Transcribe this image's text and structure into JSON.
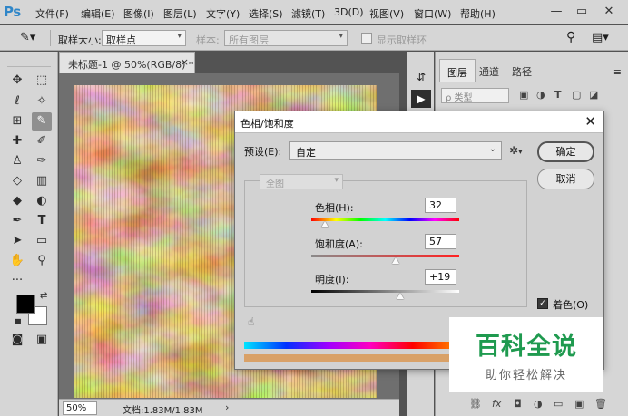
{
  "app": {
    "logo": "Ps"
  },
  "menubar": {
    "items": [
      "文件(F)",
      "编辑(E)",
      "图像(I)",
      "图层(L)",
      "文字(Y)",
      "选择(S)",
      "滤镜(T)",
      "3D(D)",
      "视图(V)",
      "窗口(W)",
      "帮助(H)"
    ],
    "window_controls": {
      "minimize": "—",
      "restore": "▭",
      "close": "✕"
    }
  },
  "options": {
    "sample_size_label": "取样大小:",
    "sample_size_value": "取样点",
    "sample_label": "样本:",
    "sample_value": "所有图层",
    "show_ring_label": "显示取样环"
  },
  "document": {
    "tab_title": "未标题-1 @ 50%(RGB/8) *",
    "tab_close": "×",
    "zoom": "50%",
    "doc_size": "文档:1.83M/1.83M",
    "status_arrow": "›"
  },
  "tools": {
    "items": [
      {
        "name": "move-tool",
        "glyph": "✥"
      },
      {
        "name": "marquee-tool",
        "glyph": "⬚"
      },
      {
        "name": "lasso-tool",
        "glyph": "ℓ"
      },
      {
        "name": "magic-wand-tool",
        "glyph": "✧"
      },
      {
        "name": "crop-tool",
        "glyph": "⊞"
      },
      {
        "name": "eyedropper-tool",
        "glyph": "✎"
      },
      {
        "name": "healing-tool",
        "glyph": "✚"
      },
      {
        "name": "brush-tool",
        "glyph": "✐"
      },
      {
        "name": "stamp-tool",
        "glyph": "♙"
      },
      {
        "name": "history-brush-tool",
        "glyph": "✑"
      },
      {
        "name": "eraser-tool",
        "glyph": "◇"
      },
      {
        "name": "gradient-tool",
        "glyph": "▥"
      },
      {
        "name": "blur-tool",
        "glyph": "◆"
      },
      {
        "name": "dodge-tool",
        "glyph": "◐"
      },
      {
        "name": "pen-tool",
        "glyph": "✒"
      },
      {
        "name": "type-tool",
        "glyph": "T"
      },
      {
        "name": "path-select-tool",
        "glyph": "➤"
      },
      {
        "name": "shape-tool",
        "glyph": "▭"
      },
      {
        "name": "hand-tool",
        "glyph": "✋"
      },
      {
        "name": "zoom-tool",
        "glyph": "⚲"
      }
    ],
    "more": "···",
    "foreground_color": "#000000",
    "background_color": "#ffffff",
    "quick_mask": "◙",
    "screen_mode": "▣"
  },
  "layers_panel": {
    "tabs": [
      "图层",
      "通道",
      "路径"
    ],
    "menu_icon": "≡",
    "filter_placeholder": "ρ 类型",
    "filter_icons": [
      "▣",
      "◑",
      "T",
      "▢",
      "◪"
    ],
    "footer_icons": [
      "⛓",
      "fx",
      "◘",
      "◑",
      "▭",
      "▣",
      "🗑"
    ]
  },
  "dialog": {
    "title": "色相/饱和度",
    "close": "✕",
    "preset_label": "预设(E):",
    "preset_value": "自定",
    "gear": "✲",
    "channel": "全图",
    "ok": "确定",
    "cancel": "取消",
    "hue_label": "色相(H):",
    "hue_value": "32",
    "hue_frac": 0.09,
    "saturation_label": "饱和度(A):",
    "saturation_value": "57",
    "saturation_frac": 0.57,
    "lightness_label": "明度(I):",
    "lightness_value": "+19",
    "lightness_frac": 0.6,
    "colorize_label": "着色(O)",
    "colorize_checked": "✓",
    "eyedrop_icon": "☝"
  },
  "watermark": {
    "title": "百科全说",
    "subtitle": "助你轻松解决"
  }
}
